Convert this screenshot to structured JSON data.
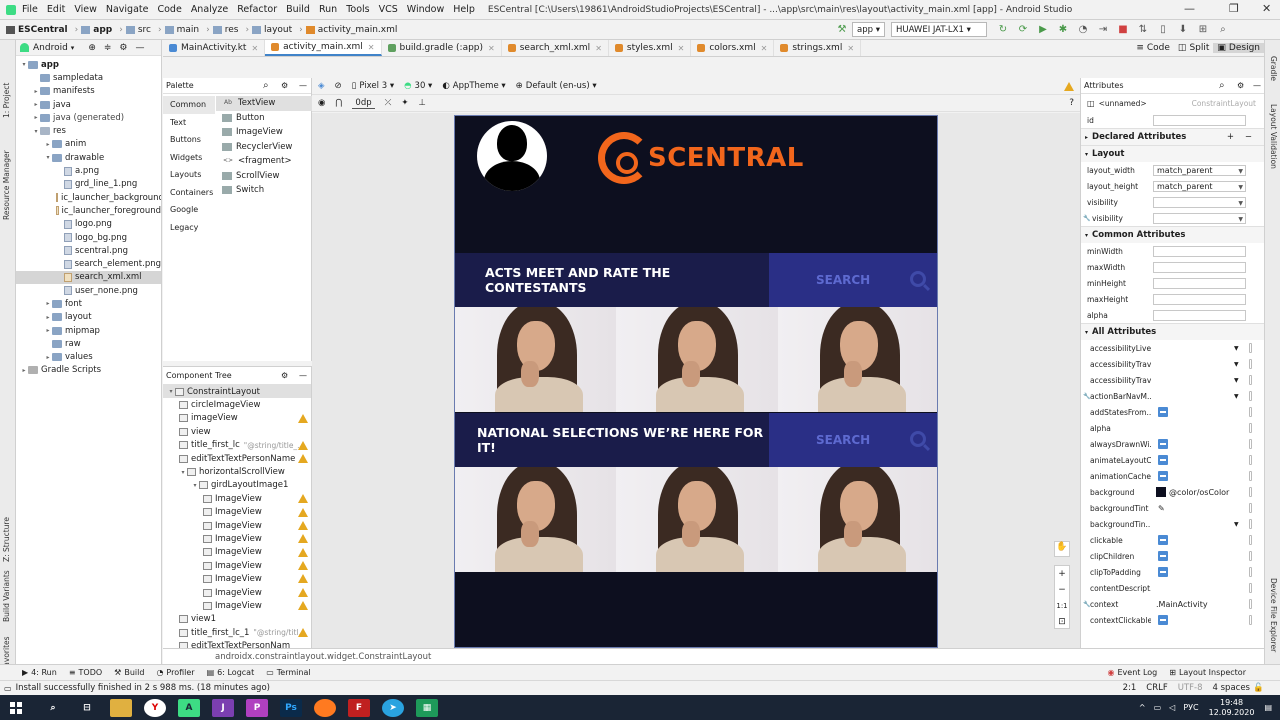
{
  "menubar": {
    "items": [
      "File",
      "Edit",
      "View",
      "Navigate",
      "Code",
      "Analyze",
      "Refactor",
      "Build",
      "Run",
      "Tools",
      "VCS",
      "Window",
      "Help"
    ],
    "title": "ESCentral [C:\\Users\\19861\\AndroidStudioProjects\\ESCentral] - ...\\app\\src\\main\\res\\layout\\activity_main.xml [app] - Android Studio"
  },
  "navbar": {
    "breadcrumbs": [
      "ESCentral",
      "app",
      "src",
      "main",
      "res",
      "layout",
      "activity_main.xml"
    ],
    "run_config": "app",
    "device": "HUAWEI JAT-LX1"
  },
  "leftstrip": [
    "1: Project",
    "Resource Manager",
    "Z: Structure",
    "Build Variants",
    "2: Favorites"
  ],
  "rightstrip": [
    "Gradle",
    "Layout Validation",
    "Device File Explorer"
  ],
  "project": {
    "view_label": "Android",
    "tree": [
      {
        "label": "app",
        "level": 0,
        "kind": "folder",
        "arrow": "▾",
        "bold": true
      },
      {
        "label": "sampledata",
        "level": 1,
        "kind": "folder",
        "arrow": ""
      },
      {
        "label": "manifests",
        "level": 1,
        "kind": "folder",
        "arrow": "▸"
      },
      {
        "label": "java",
        "level": 1,
        "kind": "folder",
        "arrow": "▸"
      },
      {
        "label": "java (generated)",
        "level": 1,
        "kind": "folder",
        "arrow": "▸"
      },
      {
        "label": "res",
        "level": 1,
        "kind": "res",
        "arrow": "▾"
      },
      {
        "label": "anim",
        "level": 2,
        "kind": "folder",
        "arrow": "▸"
      },
      {
        "label": "drawable",
        "level": 2,
        "kind": "folder",
        "arrow": "▾"
      },
      {
        "label": "a.png",
        "level": 3,
        "kind": "file",
        "arrow": ""
      },
      {
        "label": "grd_line_1.png",
        "level": 3,
        "kind": "file",
        "arrow": ""
      },
      {
        "label": "ic_launcher_background",
        "level": 3,
        "kind": "xml",
        "arrow": ""
      },
      {
        "label": "ic_launcher_foreground",
        "level": 3,
        "kind": "xml",
        "arrow": ""
      },
      {
        "label": "logo.png",
        "level": 3,
        "kind": "file",
        "arrow": ""
      },
      {
        "label": "logo_bg.png",
        "level": 3,
        "kind": "file",
        "arrow": ""
      },
      {
        "label": "scentral.png",
        "level": 3,
        "kind": "file",
        "arrow": ""
      },
      {
        "label": "search_element.png",
        "level": 3,
        "kind": "file",
        "arrow": ""
      },
      {
        "label": "search_xml.xml",
        "level": 3,
        "kind": "xml",
        "arrow": "",
        "selected": true
      },
      {
        "label": "user_none.png",
        "level": 3,
        "kind": "file",
        "arrow": ""
      },
      {
        "label": "font",
        "level": 2,
        "kind": "folder",
        "arrow": "▸"
      },
      {
        "label": "layout",
        "level": 2,
        "kind": "folder",
        "arrow": "▸"
      },
      {
        "label": "mipmap",
        "level": 2,
        "kind": "folder",
        "arrow": "▸"
      },
      {
        "label": "raw",
        "level": 2,
        "kind": "folder",
        "arrow": ""
      },
      {
        "label": "values",
        "level": 2,
        "kind": "folder",
        "arrow": "▸"
      },
      {
        "label": "Gradle Scripts",
        "level": 0,
        "kind": "gray",
        "arrow": "▸"
      }
    ]
  },
  "tabs": [
    {
      "label": "MainActivity.kt",
      "color": "#4a8ad4",
      "active": false
    },
    {
      "label": "activity_main.xml",
      "color": "#e08a2c",
      "active": true
    },
    {
      "label": "build.gradle (:app)",
      "color": "#5fa05f",
      "active": false
    },
    {
      "label": "search_xml.xml",
      "color": "#e08a2c",
      "active": false
    },
    {
      "label": "styles.xml",
      "color": "#e08a2c",
      "active": false
    },
    {
      "label": "colors.xml",
      "color": "#e08a2c",
      "active": false
    },
    {
      "label": "strings.xml",
      "color": "#e08a2c",
      "active": false
    }
  ],
  "viewmodes": [
    "Code",
    "Split",
    "Design"
  ],
  "palette": {
    "title": "Palette",
    "categories": [
      "Common",
      "Text",
      "Buttons",
      "Widgets",
      "Layouts",
      "Containers",
      "Google",
      "Legacy"
    ],
    "items": [
      "TextView",
      "Button",
      "ImageView",
      "RecyclerView",
      "<fragment>",
      "ScrollView",
      "Switch"
    ],
    "item_icons": [
      "Ab",
      "",
      "",
      "",
      "<>",
      "",
      ""
    ]
  },
  "design_toolbar": {
    "device": "Pixel 3",
    "api": "30",
    "theme": "AppTheme",
    "locale": "Default (en-us)",
    "margin": "0dp"
  },
  "component_tree": {
    "title": "Component Tree",
    "items": [
      {
        "label": "ConstraintLayout",
        "level": 0,
        "warn": false,
        "sub": "",
        "sel": true
      },
      {
        "label": "circleImageView",
        "level": 1,
        "warn": false,
        "sub": ""
      },
      {
        "label": "imageView",
        "level": 1,
        "warn": true,
        "sub": ""
      },
      {
        "label": "view",
        "level": 1,
        "warn": false,
        "sub": ""
      },
      {
        "label": "title_first_lc",
        "level": 1,
        "warn": true,
        "sub": "\"@string/title_..."
      },
      {
        "label": "editTextTextPersonName",
        "level": 1,
        "warn": true,
        "sub": ""
      },
      {
        "label": "horizontalScrollView",
        "level": 1,
        "warn": false,
        "sub": ""
      },
      {
        "label": "girdLayoutImage1",
        "level": 2,
        "warn": false,
        "sub": ""
      },
      {
        "label": "ImageView",
        "level": 3,
        "warn": true,
        "sub": ""
      },
      {
        "label": "ImageView",
        "level": 3,
        "warn": true,
        "sub": ""
      },
      {
        "label": "ImageView",
        "level": 3,
        "warn": true,
        "sub": ""
      },
      {
        "label": "ImageView",
        "level": 3,
        "warn": true,
        "sub": ""
      },
      {
        "label": "ImageView",
        "level": 3,
        "warn": true,
        "sub": ""
      },
      {
        "label": "ImageView",
        "level": 3,
        "warn": true,
        "sub": ""
      },
      {
        "label": "ImageView",
        "level": 3,
        "warn": true,
        "sub": ""
      },
      {
        "label": "ImageView",
        "level": 3,
        "warn": true,
        "sub": ""
      },
      {
        "label": "ImageView",
        "level": 3,
        "warn": true,
        "sub": ""
      },
      {
        "label": "view1",
        "level": 1,
        "warn": false,
        "sub": ""
      },
      {
        "label": "title_first_lc_1",
        "level": 1,
        "warn": true,
        "sub": "\"@string/titl..."
      },
      {
        "label": "editTextTextPersonNam",
        "level": 1,
        "warn": false,
        "sub": ""
      }
    ]
  },
  "phone": {
    "logo_text": "SCENTRAL",
    "banner1": "ACTS MEET AND RATE THE CONTESTANTS",
    "banner2": "NATIONAL SELECTIONS WE’RE HERE FOR IT!",
    "search_label": "SEARCH",
    "bg_color": "#0d0f1f",
    "accent": "#f2661c"
  },
  "bottom_path": "androidx.constraintlayout.widget.ConstraintLayout",
  "attributes": {
    "title": "Attributes",
    "unnamed": "<unnamed>",
    "class": "ConstraintLayout",
    "id_label": "id",
    "declared_header": "Declared Attributes",
    "layout_header": "Layout",
    "layout": [
      {
        "name": "layout_width",
        "value": "match_parent",
        "dd": true
      },
      {
        "name": "layout_height",
        "value": "match_parent",
        "dd": true
      },
      {
        "name": "visibility",
        "value": "",
        "dd": true
      },
      {
        "name": "visibility",
        "value": "",
        "dd": true
      }
    ],
    "common_header": "Common Attributes",
    "common": [
      "minWidth",
      "maxWidth",
      "minHeight",
      "maxHeight",
      "alpha"
    ],
    "all_header": "All Attributes",
    "all": [
      {
        "name": "accessibilityLive...",
        "type": "dd"
      },
      {
        "name": "accessibilityTrav...",
        "type": "dd"
      },
      {
        "name": "accessibilityTrav...",
        "type": "dd"
      },
      {
        "name": "actionBarNavM...",
        "type": "dd"
      },
      {
        "name": "addStatesFrom...",
        "type": "chk"
      },
      {
        "name": "alpha",
        "type": "none"
      },
      {
        "name": "alwaysDrawnWi...",
        "type": "chk"
      },
      {
        "name": "animateLayoutC...",
        "type": "chk"
      },
      {
        "name": "animationCache",
        "type": "chk"
      },
      {
        "name": "background",
        "type": "color",
        "value": "@color/osColor"
      },
      {
        "name": "backgroundTint",
        "type": "none"
      },
      {
        "name": "backgroundTin...",
        "type": "dd"
      },
      {
        "name": "clickable",
        "type": "chk"
      },
      {
        "name": "clipChildren",
        "type": "chk"
      },
      {
        "name": "clipToPadding",
        "type": "chk"
      },
      {
        "name": "contentDescript...",
        "type": "none"
      },
      {
        "name": "context",
        "type": "text",
        "value": ".MainActivity"
      },
      {
        "name": "contextClickable",
        "type": "chk"
      }
    ]
  },
  "status1": {
    "items": [
      "4: Run",
      "TODO",
      "Build",
      "Profiler",
      "6: Logcat",
      "Terminal"
    ],
    "right": [
      "Event Log",
      "Layout Inspector"
    ]
  },
  "status2": {
    "message": "Install successfully finished in 2 s 988 ms. (18 minutes ago)",
    "right": [
      "2:1",
      "CRLF",
      "UTF-8",
      "4 spaces"
    ]
  },
  "taskbar": {
    "lang": "РУС",
    "time": "19:48",
    "date": "12.09.2020"
  }
}
